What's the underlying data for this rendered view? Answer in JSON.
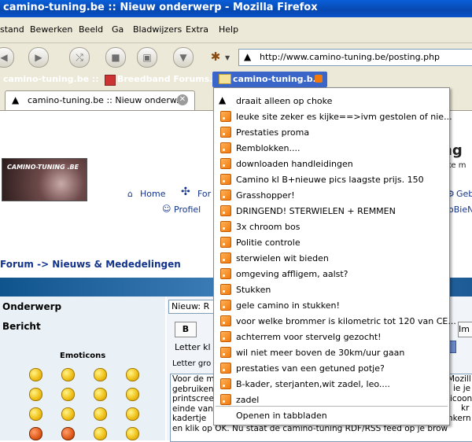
{
  "window": {
    "title": "camino-tuning.be :: Nieuw onderwerp - Mozilla Firefox"
  },
  "menu": [
    "stand",
    "Bewerken",
    "Beeld",
    "Ga",
    "Bladwijzers",
    "Extra",
    "Help"
  ],
  "navbar": {
    "url": "http://www.camino-tuning.be/posting.php"
  },
  "bookmarks": [
    "camino-tuning.be ::",
    "Breedband Forums...",
    "camino-tuning.b..."
  ],
  "tab": {
    "label": "camino-tuning.be :: Nieuw onderw..."
  },
  "page": {
    "logo_text": "CAMINO-TUNING .BE",
    "header_title_partial": "ng",
    "header_subtitle_partial": "ke m",
    "nav": {
      "home": "Home",
      "forum_partial": "For",
      "profiel": "Profiel",
      "right1_partial": "Geb",
      "right2_partial": "oBieN"
    },
    "breadcrumb": "Forum -> Nieuws & Mededelingen",
    "onderwerp_label": "Onderwerp",
    "bericht_label": "Bericht",
    "subject_value": "Nieuw: R",
    "bold_button": "B",
    "im_button": "Im",
    "letter_label1": "Letter kl",
    "letter_label2": "Letter gro",
    "emoticons_title": "Emoticons",
    "textarea_lines": [
      "Voor de m",
      "gebruiken",
      "printscree",
      "einde van",
      "kadertje",
      "en klik op OK. Nu staat de camino-tuning RDF/RSS feed op je brow"
    ],
    "textarea_right": [
      "Mozill",
      "ie je",
      "icoon",
      "kr",
      "nkern"
    ]
  },
  "feed_dropdown": {
    "items": [
      "draait alleen op choke",
      "leuke site zeker es kijke==>ivm gestolen of nie...",
      "Prestaties proma",
      "Remblokken....",
      "downloaden handleidingen",
      "Camino kl B+nieuwe pics laagste prijs. 150",
      "Grasshopper!",
      "DRINGEND! STERWIELEN + REMMEN",
      "3x chroom bos",
      "Politie controle",
      "sterwielen wit bieden",
      "omgeving affligem, aalst?",
      "Stukken",
      "gele camino in stukken!",
      "voor welke brommer is kilometric tot 120 van CE...",
      "achterrem voor stervelg gezocht!",
      "wil niet meer boven de 30km/uur gaan",
      "prestaties van een getuned potje?",
      "B-kader, sterjanten,wit zadel, leo....",
      "zadel"
    ],
    "open_in_tabs": "Openen in tabbladen"
  }
}
